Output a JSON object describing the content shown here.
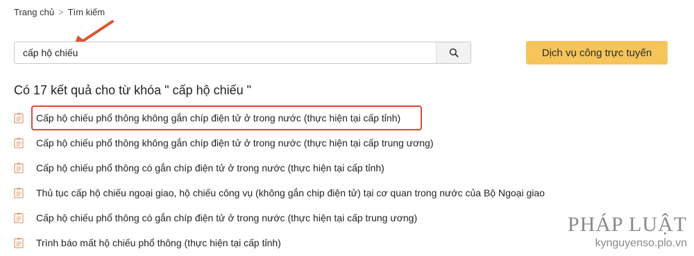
{
  "breadcrumb": {
    "home": "Trang chủ",
    "separator": ">",
    "current": "Tìm kiếm"
  },
  "search": {
    "value": "cấp hộ chiếu",
    "button_icon": "search-icon"
  },
  "service_button": {
    "label": "Dịch vụ công trực tuyến"
  },
  "results": {
    "heading": "Có 17 kết quả cho từ khóa \" cấp hộ chiếu \"",
    "items": [
      "Cấp hộ chiếu phổ thông không gắn chíp điện tử ở trong nước (thực hiện tại cấp tỉnh)",
      "Cấp hộ chiếu phổ thông không gắn chíp điện tử ở trong nước (thực hiện tại cấp trung ương)",
      "Cấp hộ chiếu phổ thông có gắn chíp điện tử ở trong nước (thực hiện tại cấp tỉnh)",
      "Thủ tục cấp hộ chiếu ngoại giao, hộ chiếu công vụ (không gắn chip điện tử) tại cơ quan trong nước của Bộ Ngoại giao",
      "Cấp hộ chiếu phổ thông có gắn chíp điện tử ở trong nước (thực hiện tại cấp trung ương)",
      "Trình báo mất hộ chiếu phổ thông (thực hiện tại cấp tỉnh)"
    ],
    "item_icon": "clipboard-icon"
  },
  "colors": {
    "accent_button": "#f5c45a",
    "annotation": "#d94a2b",
    "doc_icon": "#e0a27a"
  },
  "watermark": {
    "brand": "PHÁP LUẬT",
    "site": "kynguyenso.plo.vn"
  }
}
